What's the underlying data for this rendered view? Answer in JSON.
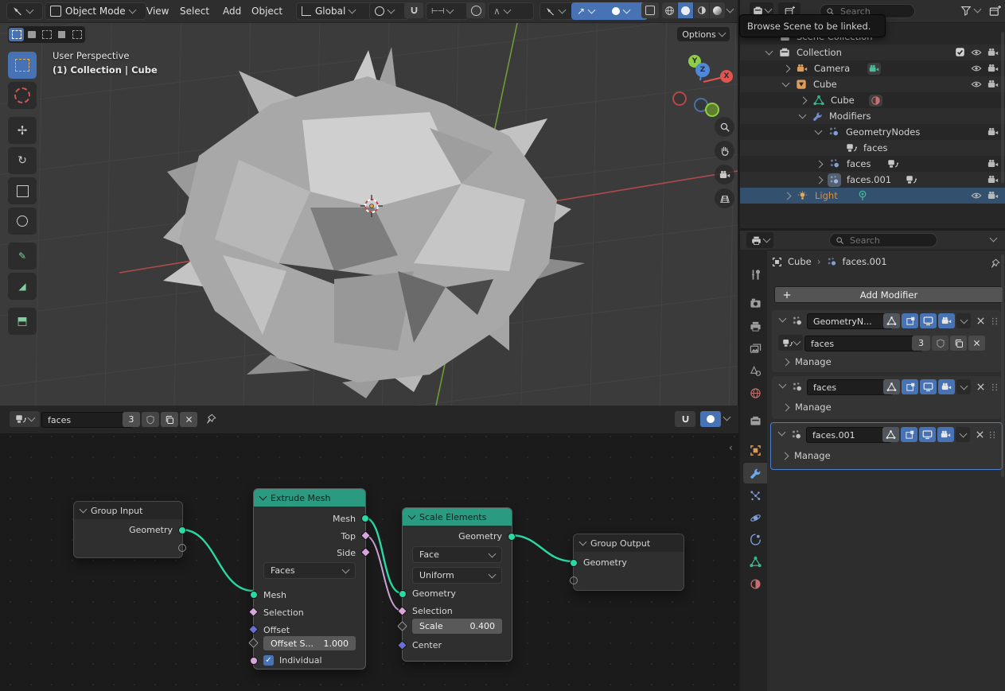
{
  "topbar": {
    "mode": "Object Mode",
    "menus": {
      "view": "View",
      "select": "Select",
      "add": "Add",
      "object": "Object"
    },
    "orientation": "Global"
  },
  "tooltip": "Browse Scene to be linked.",
  "viewport": {
    "perspective_label": "User Perspective",
    "context_label": "(1) Collection | Cube",
    "options_label": "Options",
    "axis": {
      "x": "X",
      "y": "Y",
      "z": "Z"
    }
  },
  "outliner": {
    "search_placeholder": "Search",
    "rows": [
      {
        "label": "Scene Collection"
      },
      {
        "label": "Collection"
      },
      {
        "label": "Camera"
      },
      {
        "label": "Cube"
      },
      {
        "label": "Cube"
      },
      {
        "label": "Modifiers"
      },
      {
        "label": "GeometryNodes"
      },
      {
        "label": "faces"
      },
      {
        "label": "faces"
      },
      {
        "label": "faces.001"
      },
      {
        "label": "Light"
      }
    ]
  },
  "properties": {
    "search_placeholder": "Search",
    "breadcrumb": {
      "object": "Cube",
      "separator": "›",
      "data": "faces.001"
    },
    "add_modifier_label": "Add Modifier",
    "manage_label": "Manage",
    "modifiers": [
      {
        "name": "GeometryN..."
      },
      {
        "name": "faces"
      },
      {
        "name": "faces.001"
      }
    ],
    "node_tree": {
      "name": "faces",
      "users": "3"
    }
  },
  "node_editor": {
    "tree": {
      "name": "faces",
      "users": "3"
    },
    "group_input": {
      "title": "Group Input",
      "out_geometry": "Geometry"
    },
    "extrude_mesh": {
      "title": "Extrude Mesh",
      "out_mesh": "Mesh",
      "out_top": "Top",
      "out_side": "Side",
      "mode": "Faces",
      "in_mesh": "Mesh",
      "in_selection": "Selection",
      "in_offset": "Offset",
      "offset_scale_label": "Offset S...",
      "offset_scale_value": "1.000",
      "individual_label": "Individual"
    },
    "scale_elements": {
      "title": "Scale Elements",
      "out_geometry": "Geometry",
      "domain": "Face",
      "scale_mode": "Uniform",
      "in_geometry": "Geometry",
      "in_selection": "Selection",
      "scale_label": "Scale",
      "scale_value": "0.400",
      "in_center": "Center"
    },
    "group_output": {
      "title": "Group Output",
      "in_geometry": "Geometry"
    }
  },
  "colors": {
    "accent": "#4772b3",
    "node_header_teal": "#2a9a80",
    "socket_geometry": "#2bd9a4",
    "socket_boolean_field": "#d8a5dd",
    "socket_vector": "#6b6fd0",
    "active_object_text": "#e08b33"
  }
}
